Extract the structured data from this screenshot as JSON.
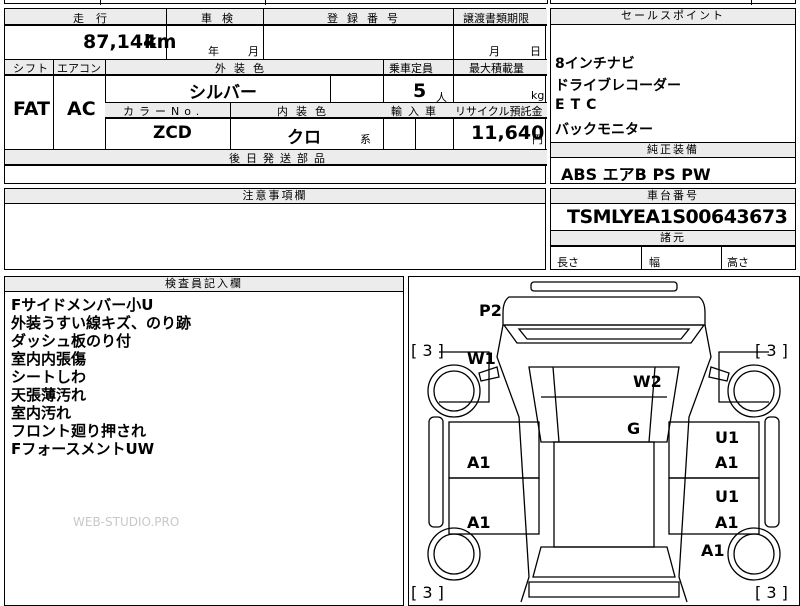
{
  "top_partial": {
    "left": "",
    "mid": "登録番号"
  },
  "mileage": {
    "header": "走行",
    "value": "87,144",
    "unit": "km"
  },
  "inspection": {
    "header": "車検",
    "year_unit": "年",
    "month_unit": "月"
  },
  "registration": {
    "header": "登録番号",
    "value": ""
  },
  "transfer_deadline": {
    "header": "譲渡書類期限",
    "month_unit": "月",
    "day_unit": "日"
  },
  "shift": {
    "header": "シフト",
    "value": "FAT"
  },
  "aircon": {
    "header": "エアコン",
    "value": "AC"
  },
  "exterior_color": {
    "header": "外装色",
    "value": "シルバー"
  },
  "capacity": {
    "header": "乗車定員",
    "value": "5",
    "unit": "人"
  },
  "max_load": {
    "header": "最大積載量",
    "value": "",
    "unit": "kg"
  },
  "color_no": {
    "header": "カラーNo.",
    "value": "ZCD"
  },
  "interior_color": {
    "header": "内装色",
    "value": "クロ",
    "suffix": "系"
  },
  "import": {
    "header": "輸入車",
    "value": ""
  },
  "recycle": {
    "header": "リサイクル預託金",
    "value": "11,640",
    "unit": "円"
  },
  "later_parts": {
    "header": "後日発送部品"
  },
  "sales_points": {
    "header": "セールスポイント",
    "items": [
      "8インチナビ",
      "ドライブレコーダー",
      "ETC",
      "バックモニター"
    ]
  },
  "genuine_equipment": {
    "header": "純正装備",
    "value": "ABS エアB PS PW"
  },
  "caution": {
    "header": "注意事項欄"
  },
  "chassis": {
    "header": "車台番号",
    "value": "TSMLYEA1S00643673"
  },
  "dimensions": {
    "header": "諸元",
    "length": "長さ",
    "width": "幅",
    "height": "高さ"
  },
  "inspector_notes": {
    "header": "検査員記入欄",
    "lines": [
      "Fサイドメンバー小U",
      "外装うすい線キズ、のり跡",
      "ダッシュ板のり付",
      "室内内張傷",
      "シートしわ",
      "天張薄汚れ",
      "室内汚れ",
      "フロント廻り押され",
      "FフォースメントUW"
    ]
  },
  "watermark": "WEB-STUDIO.PRO",
  "diagram": {
    "marks": {
      "p2": "P2",
      "w1": "W1",
      "w2": "W2",
      "g": "G",
      "a1_left_front": "A1",
      "a1_left_rear": "A1",
      "u1_right_front": "U1",
      "a1_right_front": "A1",
      "u1_right_rear": "U1",
      "a1_right_rear": "A1",
      "a1_right_bottom": "A1"
    },
    "tires": {
      "front_left": "[ 3 ]",
      "front_right": "[ 3 ]",
      "rear_left": "[ 3 ]",
      "rear_right": "[ 3 ]"
    }
  }
}
